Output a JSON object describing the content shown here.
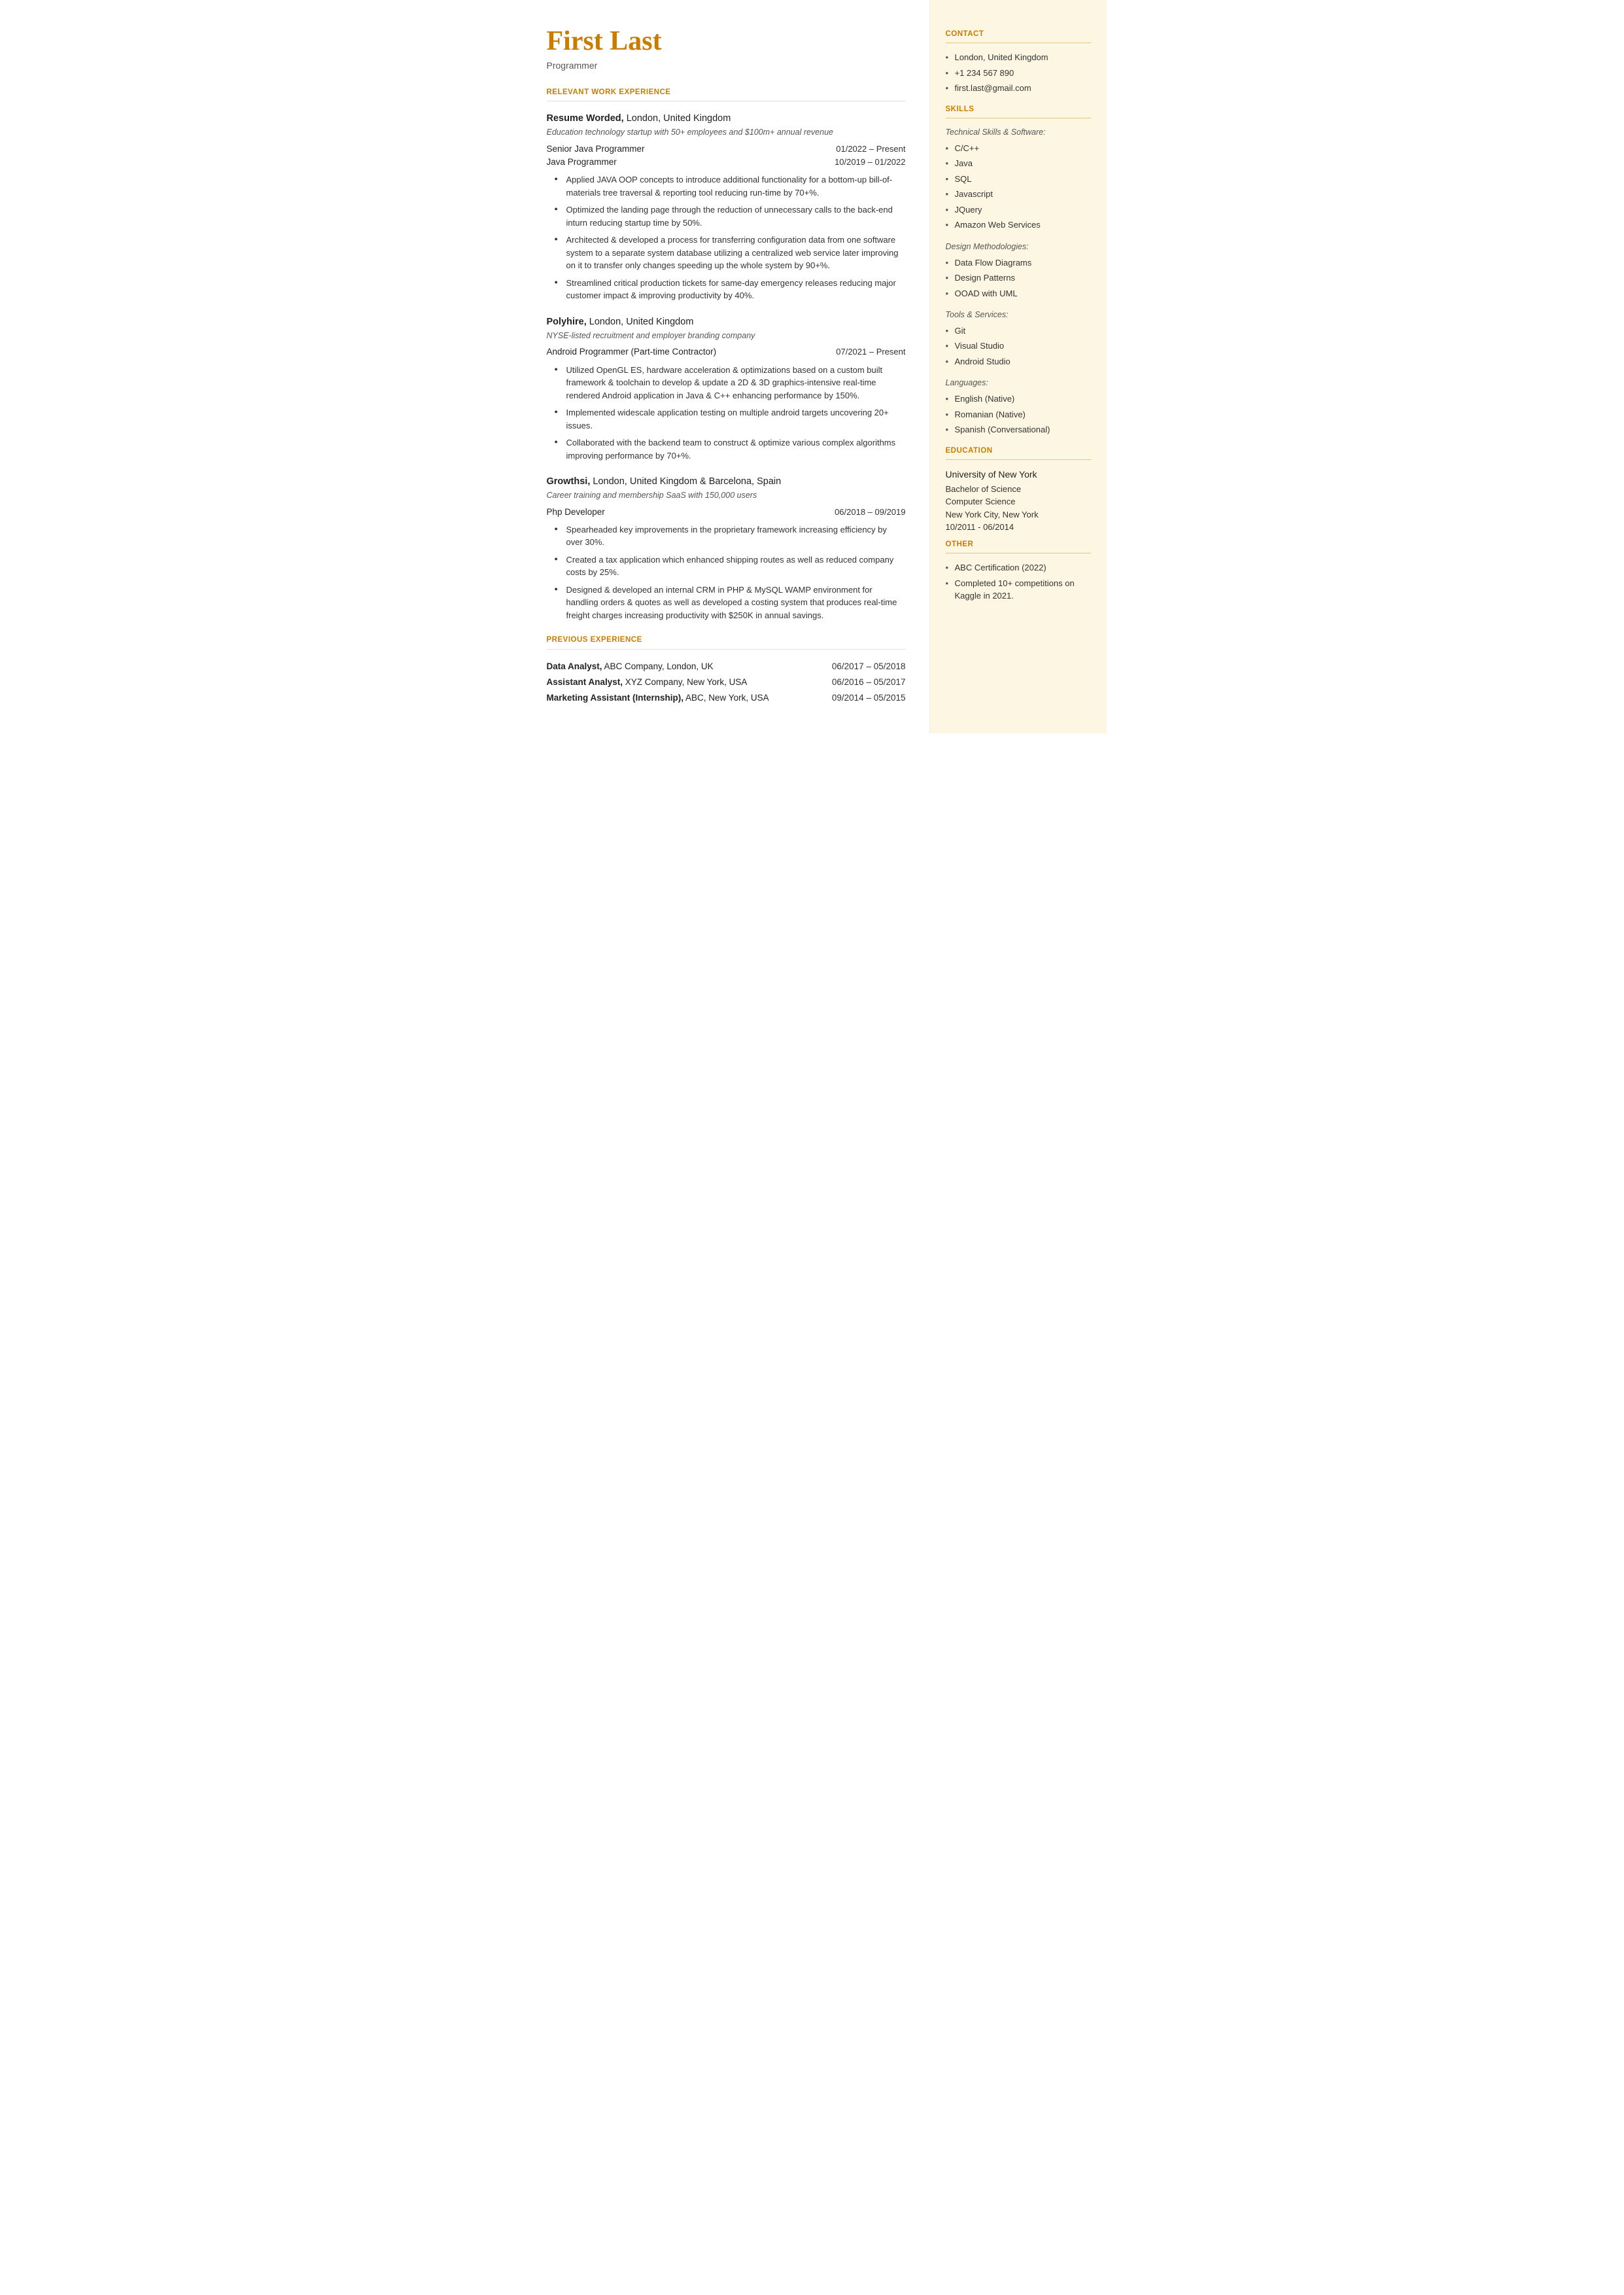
{
  "header": {
    "name": "First Last",
    "title": "Programmer"
  },
  "left": {
    "relevant_work_header": "RELEVANT WORK EXPERIENCE",
    "companies": [
      {
        "name": "Resume Worded,",
        "name_rest": " London, United Kingdom",
        "description": "Education technology startup with 50+ employees and $100m+ annual revenue",
        "roles": [
          {
            "title": "Senior Java Programmer",
            "date": "01/2022 – Present"
          },
          {
            "title": "Java Programmer",
            "date": "10/2019 – 01/2022"
          }
        ],
        "bullets": [
          "Applied JAVA OOP concepts to introduce additional functionality for a bottom-up bill-of-materials tree traversal & reporting tool reducing run-time by 70+%.",
          "Optimized the landing page through the reduction of unnecessary calls to the back-end inturn reducing startup time by 50%.",
          "Architected & developed a process for transferring configuration data from one software system to a separate system database utilizing a centralized web service later improving on it to transfer only changes speeding up the whole system by 90+%.",
          "Streamlined critical production tickets for same-day emergency releases reducing major customer impact & improving productivity by 40%."
        ]
      },
      {
        "name": "Polyhire,",
        "name_rest": " London, United Kingdom",
        "description": "NYSE-listed recruitment and employer branding company",
        "roles": [
          {
            "title": "Android Programmer (Part-time Contractor)",
            "date": "07/2021 – Present"
          }
        ],
        "bullets": [
          "Utilized OpenGL ES, hardware acceleration & optimizations based on a custom built framework & toolchain to develop & update a 2D & 3D graphics-intensive real-time rendered Android application in Java & C++ enhancing performance by 150%.",
          "Implemented widescale application testing on multiple android targets uncovering 20+ issues.",
          "Collaborated with the backend team to construct & optimize various complex algorithms improving performance by 70+%."
        ]
      },
      {
        "name": "Growthsi,",
        "name_rest": " London, United Kingdom & Barcelona, Spain",
        "description": "Career training and membership SaaS with 150,000 users",
        "roles": [
          {
            "title": "Php Developer",
            "date": "06/2018 – 09/2019"
          }
        ],
        "bullets": [
          "Spearheaded key improvements in the proprietary framework increasing efficiency by over 30%.",
          "Created a tax application which enhanced shipping routes as well as reduced company costs by 25%.",
          "Designed & developed an internal CRM in PHP & MySQL WAMP environment for handling orders & quotes as well as developed a costing system that produces real-time freight charges increasing productivity with $250K in annual savings."
        ]
      }
    ],
    "previous_experience_header": "PREVIOUS EXPERIENCE",
    "previous_roles": [
      {
        "bold": "Data Analyst,",
        "rest": " ABC Company, London, UK",
        "date": "06/2017 – 05/2018"
      },
      {
        "bold": "Assistant Analyst,",
        "rest": " XYZ Company, New York, USA",
        "date": "06/2016 – 05/2017"
      },
      {
        "bold": "Marketing Assistant (Internship),",
        "rest": " ABC, New York, USA",
        "date": "09/2014 – 05/2015"
      }
    ]
  },
  "right": {
    "contact_header": "CONTACT",
    "contact": [
      "London, United Kingdom",
      "+1 234 567 890",
      "first.last@gmail.com"
    ],
    "skills_header": "SKILLS",
    "skills": {
      "technical_label": "Technical Skills & Software:",
      "technical": [
        "C/C++",
        "Java",
        "SQL",
        "Javascript",
        "JQuery",
        "Amazon Web Services"
      ],
      "design_label": "Design Methodologies:",
      "design": [
        "Data Flow Diagrams",
        "Design Patterns",
        "OOAD with UML"
      ],
      "tools_label": "Tools & Services:",
      "tools": [
        "Git",
        "Visual Studio",
        "Android Studio"
      ],
      "languages_label": "Languages:",
      "languages": [
        "English (Native)",
        "Romanian (Native)",
        "Spanish (Conversational)"
      ]
    },
    "education_header": "EDUCATION",
    "education": {
      "university": "University of New York",
      "degree": "Bachelor of Science",
      "field": "Computer Science",
      "location": "New York City, New York",
      "dates": "10/2011 - 06/2014"
    },
    "other_header": "OTHER",
    "other": [
      "ABC Certification (2022)",
      "Completed 10+ competitions on Kaggle in 2021."
    ]
  }
}
